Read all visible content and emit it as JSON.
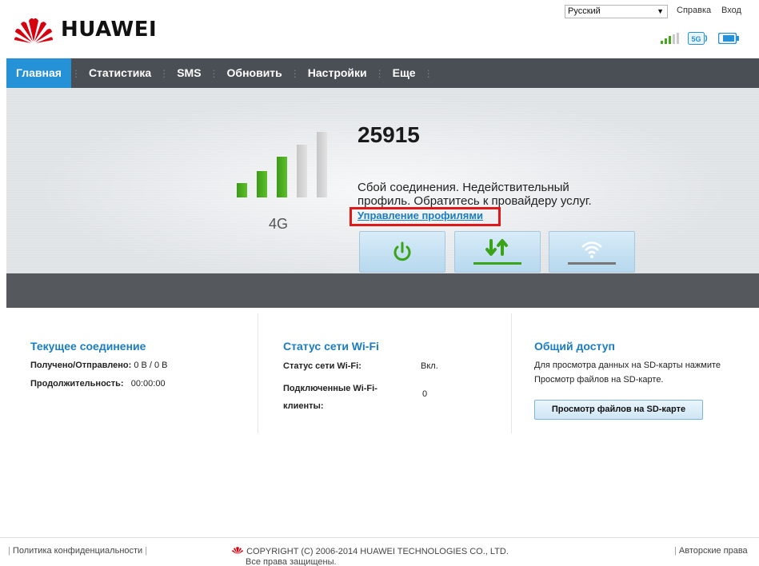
{
  "header": {
    "brand": "HUAWEI",
    "language": "Русский",
    "help_label": "Справка",
    "login_label": "Вход",
    "network_badge": "5G"
  },
  "nav": {
    "items": [
      {
        "label": "Главная",
        "active": true
      },
      {
        "label": "Статистика",
        "active": false
      },
      {
        "label": "SMS",
        "active": false
      },
      {
        "label": "Обновить",
        "active": false
      },
      {
        "label": "Настройки",
        "active": false
      },
      {
        "label": "Еще",
        "active": false
      }
    ]
  },
  "hero": {
    "network_type": "4G",
    "signal_level": 3,
    "signal_max": 5,
    "profile_name": "25915",
    "status_message": "Сбой соединения. Недействительный профиль. Обратитесь к провайдеру услуг.",
    "manage_link": "Управление профилями",
    "buttons": [
      {
        "name": "power",
        "icon": "power-icon"
      },
      {
        "name": "mobile-data",
        "icon": "data-transfer-icon"
      },
      {
        "name": "wifi",
        "icon": "wifi-icon"
      }
    ]
  },
  "connection": {
    "title": "Текущее соединение",
    "traffic_label": "Получено/Отправлено:",
    "traffic_value": "0 B /  0 B",
    "duration_label": "Продолжительность:",
    "duration_value": "00:00:00"
  },
  "wifi": {
    "title": "Статус сети Wi-Fi",
    "status_label": "Статус сети Wi-Fi:",
    "status_value": "Вкл.",
    "clients_label_1": "Подключенные Wi-Fi-",
    "clients_label_2": "клиенты:",
    "clients_value": "0"
  },
  "sharing": {
    "title": "Общий доступ",
    "description_1": "Для просмотра данных на SD-карты нажмите",
    "description_2": "Просмотр файлов на SD-карте.",
    "button_label": "Просмотр файлов на SD-карте"
  },
  "footer": {
    "privacy": "Политика конфиденциальности",
    "copyright_1": "COPYRIGHT (C) 2006-2014 HUAWEI TECHNOLOGIES CO., LTD.",
    "copyright_2": "Все права защищены.",
    "rights": "Авторские права"
  },
  "colors": {
    "accent": "#2591d6",
    "link": "#1a7cc1",
    "signal_on": "#45a81e",
    "signal_off": "#d3d3d3",
    "highlight": "#e01818",
    "brand_red": "#d7000f"
  }
}
